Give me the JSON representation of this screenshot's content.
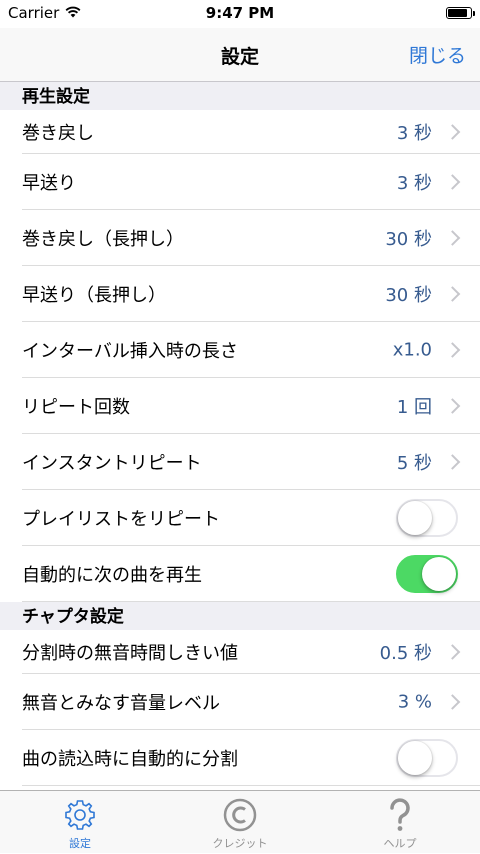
{
  "status_bar": {
    "carrier": "Carrier",
    "time": "9:47 PM"
  },
  "nav": {
    "title": "設定",
    "close_label": "閉じる"
  },
  "sections": {
    "playback": {
      "header": "再生設定",
      "rows": [
        {
          "label": "巻き戻し",
          "value": "3 秒"
        },
        {
          "label": "早送り",
          "value": "3 秒"
        },
        {
          "label": "巻き戻し（長押し）",
          "value": "30 秒"
        },
        {
          "label": "早送り（長押し）",
          "value": "30 秒"
        },
        {
          "label": "インターバル挿入時の長さ",
          "value": "x1.0"
        },
        {
          "label": "リピート回数",
          "value": "1 回"
        },
        {
          "label": "インスタントリピート",
          "value": "5 秒"
        },
        {
          "label": "プレイリストをリピート",
          "toggle": false
        },
        {
          "label": "自動的に次の曲を再生",
          "toggle": true
        }
      ]
    },
    "chapter": {
      "header": "チャプタ設定",
      "rows": [
        {
          "label": "分割時の無音時間しきい値",
          "value": "0.5 秒"
        },
        {
          "label": "無音とみなす音量レベル",
          "value": "3 %"
        },
        {
          "label": "曲の読込時に自動的に分割",
          "toggle": false
        }
      ]
    }
  },
  "tabbar": {
    "items": [
      {
        "label": "設定",
        "icon": "gear-icon",
        "active": true
      },
      {
        "label": "クレジット",
        "icon": "copyright-icon",
        "active": false
      },
      {
        "label": "ヘルプ",
        "icon": "question-icon",
        "active": false
      }
    ]
  },
  "colors": {
    "accent": "#2f78d6",
    "value_text": "#375b8f",
    "toggle_on": "#4cd964",
    "tab_inactive": "#929292"
  }
}
